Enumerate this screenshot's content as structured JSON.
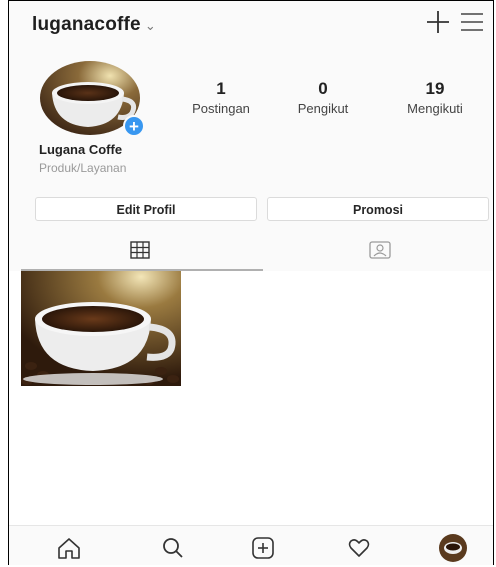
{
  "header": {
    "username": "luganacoffe",
    "chevron": "⌄"
  },
  "icons": {
    "plus": "plus-icon",
    "menu": "hamburger-menu-icon",
    "grid": "grid-icon",
    "tagged": "tagged-person-icon",
    "home": "home-icon",
    "search": "search-icon",
    "add": "add-post-icon",
    "activity": "heart-icon"
  },
  "profile": {
    "name": "Lugana Coffe",
    "category": "Produk/Layanan",
    "stats": [
      {
        "value": "1",
        "label": "Postingan"
      },
      {
        "value": "0",
        "label": "Pengikut"
      },
      {
        "value": "19",
        "label": "Mengikuti"
      }
    ],
    "add_badge": "+"
  },
  "buttons": {
    "edit_profile": "Edit Profil",
    "promotion": "Promosi"
  },
  "colors": {
    "accent": "#3897f0",
    "background": "#fafafa",
    "text": "#262626"
  }
}
